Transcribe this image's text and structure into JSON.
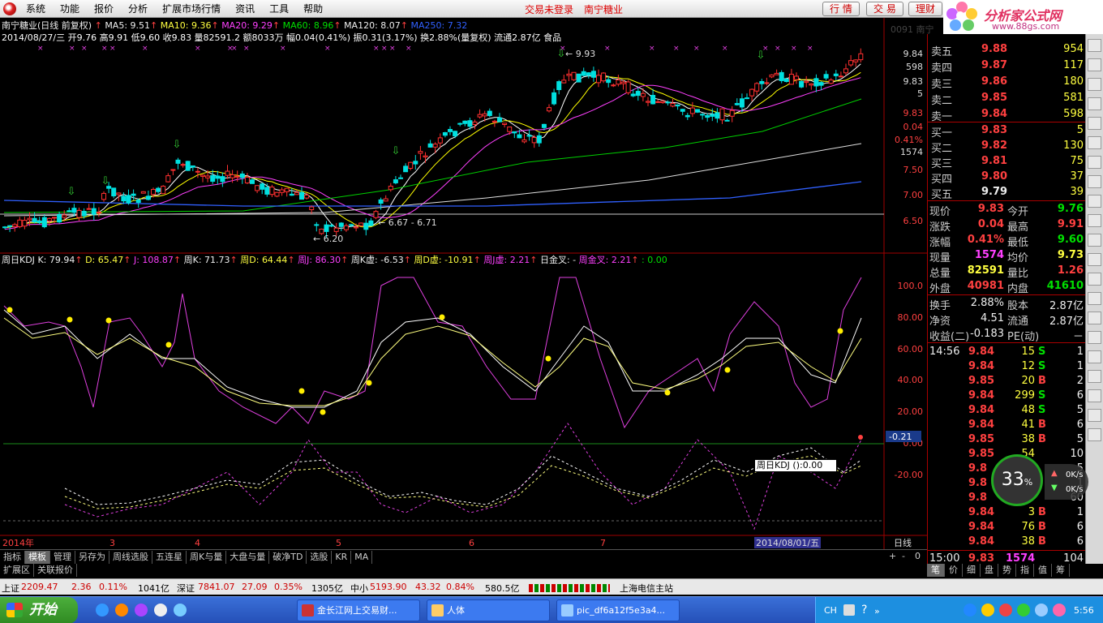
{
  "menu": {
    "items": [
      "系统",
      "功能",
      "报价",
      "分析",
      "扩展市场行情",
      "资讯",
      "工具",
      "帮助"
    ],
    "status_login": "交易未登录",
    "stock_title": "南宁糖业",
    "btn_quote": "行 情",
    "btn_trade": "交 易",
    "btn_finance": "理财"
  },
  "logo": {
    "brand": "分析家公式网",
    "url": "www.88gs.com"
  },
  "chart_header": {
    "line1_name": "南宁糖业(日线 前复权)",
    "ma5": "MA5: 9.51",
    "ma10": "MA10: 9.36",
    "ma20": "MA20: 9.29",
    "ma60": "MA60: 8.96",
    "ma120": "MA120: 8.07",
    "ma250": "MA250: 7.32",
    "line2": "2014/08/27/三 开9.76 高9.91 低9.60 收9.83 量82591.2 额8033万 幅0.04(0.41%) 振0.31(3.17%) 换2.88%(量复权) 流通2.87亿 食品",
    "ghost": "0091    南宁"
  },
  "price_axis": [
    "9.84",
    "598",
    "9.83",
    "5",
    "9.83",
    "0.04",
    "0.41%",
    "1574",
    "7.50",
    "7.00",
    "6.50"
  ],
  "annotations": {
    "high": "9.93",
    "low": "6.20",
    "range": "6.67 - 6.71"
  },
  "kdj_header": {
    "name": "周日KDJ",
    "k": "K: 79.94",
    "d": "D: 65.47",
    "j": "J: 108.87",
    "wk": "周K: 71.73",
    "wd": "周D: 64.44",
    "wj": "周J: 86.30",
    "wkx": "周K虚: -6.53",
    "wdx": "周D虚: -10.91",
    "wjx": "周J虚: 2.21",
    "dayx": "日金叉: -",
    "wkgold": "周金叉: 2.21",
    "tail": ": 0.00"
  },
  "kdj_axis": [
    "100.0",
    "80.00",
    "60.00",
    "40.00",
    "20.00",
    "0.00",
    "-20.00"
  ],
  "kdj_marker": "-0.21",
  "tooltip": "周日KDJ ():0.00",
  "time_axis": [
    "2014年",
    "3",
    "4",
    "5",
    "6",
    "7",
    "2014/08/01/五",
    "日线"
  ],
  "tabs": [
    "指标",
    "模板",
    "管理",
    "另存为",
    "周线选股",
    "五连星",
    "周K与量",
    "大盘与量",
    "破净TD",
    "选股",
    "KR",
    "MA"
  ],
  "tabs_selected": "模板",
  "tabs2": [
    "扩展区",
    "关联报价"
  ],
  "zoom_ctrl": [
    "+",
    "-",
    "0"
  ],
  "orderbook": {
    "asks": [
      {
        "label": "卖五",
        "price": "9.88",
        "vol": "954"
      },
      {
        "label": "卖四",
        "price": "9.87",
        "vol": "117"
      },
      {
        "label": "卖三",
        "price": "9.86",
        "vol": "180"
      },
      {
        "label": "卖二",
        "price": "9.85",
        "vol": "581"
      },
      {
        "label": "卖一",
        "price": "9.84",
        "vol": "598"
      }
    ],
    "bids": [
      {
        "label": "买一",
        "price": "9.83",
        "vol": "5"
      },
      {
        "label": "买二",
        "price": "9.82",
        "vol": "130"
      },
      {
        "label": "买三",
        "price": "9.81",
        "vol": "75"
      },
      {
        "label": "买四",
        "price": "9.80",
        "vol": "37"
      },
      {
        "label": "买五",
        "price": "9.79",
        "vol": "39"
      }
    ]
  },
  "stats": [
    {
      "l1": "现价",
      "v1": "9.83",
      "l2": "今开",
      "v2": "9.76"
    },
    {
      "l1": "涨跌",
      "v1": "0.04",
      "l2": "最高",
      "v2": "9.91"
    },
    {
      "l1": "涨幅",
      "v1": "0.41%",
      "l2": "最低",
      "v2": "9.60"
    },
    {
      "l1": "现量",
      "v1": "1574",
      "l2": "均价",
      "v2": "9.73"
    },
    {
      "l1": "总量",
      "v1": "82591",
      "l2": "量比",
      "v2": "1.26"
    },
    {
      "l1": "外盘",
      "v1": "40981",
      "l2": "内盘",
      "v2": "41610"
    }
  ],
  "fundamentals": [
    {
      "l1": "换手",
      "v1": "2.88%",
      "l2": "股本",
      "v2": "2.87亿"
    },
    {
      "l1": "净资",
      "v1": "4.51",
      "l2": "流通",
      "v2": "2.87亿"
    },
    {
      "l1": "收益(二)",
      "v1": "-0.183",
      "l2": "PE(动)",
      "v2": "－"
    }
  ],
  "ticks": [
    {
      "t": "14:56",
      "p": "9.84",
      "v": "15",
      "s": "S",
      "n": "1"
    },
    {
      "t": "",
      "p": "9.84",
      "v": "12",
      "s": "S",
      "n": "1"
    },
    {
      "t": "",
      "p": "9.85",
      "v": "20",
      "s": "B",
      "n": "2"
    },
    {
      "t": "",
      "p": "9.84",
      "v": "299",
      "s": "S",
      "n": "6"
    },
    {
      "t": "",
      "p": "9.84",
      "v": "48",
      "s": "S",
      "n": "5"
    },
    {
      "t": "",
      "p": "9.84",
      "v": "41",
      "s": "B",
      "n": "6"
    },
    {
      "t": "",
      "p": "9.85",
      "v": "38",
      "s": "B",
      "n": "5"
    },
    {
      "t": "",
      "p": "9.85",
      "v": "54",
      "s": "",
      "n": "10"
    },
    {
      "t": "",
      "p": "9.8",
      "v": "",
      "s": "",
      "n": "5"
    },
    {
      "t": "",
      "p": "9.8",
      "v": "",
      "s": "",
      "n": "1"
    },
    {
      "t": "",
      "p": "9.8",
      "v": "",
      "s": "",
      "n": "60"
    },
    {
      "t": "",
      "p": "9.84",
      "v": "3",
      "s": "B",
      "n": "1"
    },
    {
      "t": "",
      "p": "9.84",
      "v": "76",
      "s": "B",
      "n": "6"
    },
    {
      "t": "",
      "p": "9.84",
      "v": "38",
      "s": "B",
      "n": "6"
    }
  ],
  "last_tick": {
    "t": "15:00",
    "p": "9.83",
    "v": "1574",
    "n": "104"
  },
  "right_tabs": [
    "笔",
    "价",
    "细",
    "盘",
    "势",
    "指",
    "值",
    "筹"
  ],
  "net_gauge": {
    "percent": "33",
    "unit": "%",
    "up": "0K/s",
    "down": "0K/s"
  },
  "statusbar": {
    "sh_label": "上证",
    "sh_val": "2209.47",
    "sh_chg": "2.36",
    "sh_pct": "0.11%",
    "sh_amt": "1041亿",
    "sz_label": "深证",
    "sz_val": "7841.07",
    "sz_chg": "27.09",
    "sz_pct": "0.35%",
    "sz_amt": "1305亿",
    "zx_label": "中小",
    "zx_val": "5193.90",
    "zx_chg": "43.32",
    "zx_pct": "0.84%",
    "zx_amt": "580.5亿",
    "server": "上海电信主站"
  },
  "taskbar": {
    "start": "开始",
    "tasks": [
      "金长江网上交易财...",
      "人体",
      "pic_df6a12f5e3a4..."
    ],
    "lang": "CH",
    "clock": "5:56"
  },
  "colors": {
    "up": "#ff3030",
    "down": "#00e0e0",
    "ma5": "#ffffff",
    "ma10": "#ffff00",
    "ma20": "#ff40ff",
    "ma60": "#00d000",
    "ma120": "#e0e0e0",
    "ma250": "#3060ff",
    "axis": "#a00000"
  }
}
